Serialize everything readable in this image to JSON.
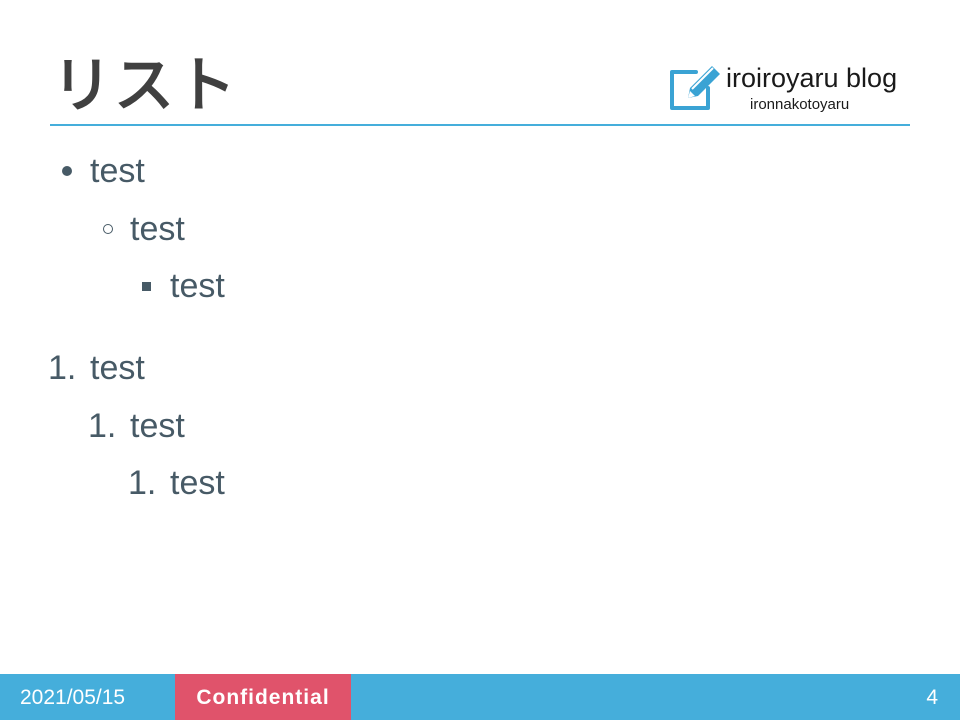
{
  "slide": {
    "title": "リスト",
    "logo": {
      "icon": "note-pencil-icon",
      "name": "iroiroyaru blog",
      "tagline": "ironnakotoyaru"
    },
    "bullet_list": [
      {
        "level": 1,
        "marker": "disc",
        "text": "test"
      },
      {
        "level": 2,
        "marker": "circle",
        "text": "test"
      },
      {
        "level": 3,
        "marker": "square",
        "text": "test"
      }
    ],
    "numbered_list": [
      {
        "level": 1,
        "number": "1.",
        "text": "test"
      },
      {
        "level": 2,
        "number": "1.",
        "text": "test"
      },
      {
        "level": 3,
        "number": "1.",
        "text": "test"
      }
    ]
  },
  "footer": {
    "date": "2021/05/15",
    "confidential": "Confidential",
    "page_number": "4"
  },
  "colors": {
    "accent_blue": "#45aedb",
    "confidential_red": "#e0536b",
    "body_text": "#475a66",
    "title_text": "#404040"
  }
}
